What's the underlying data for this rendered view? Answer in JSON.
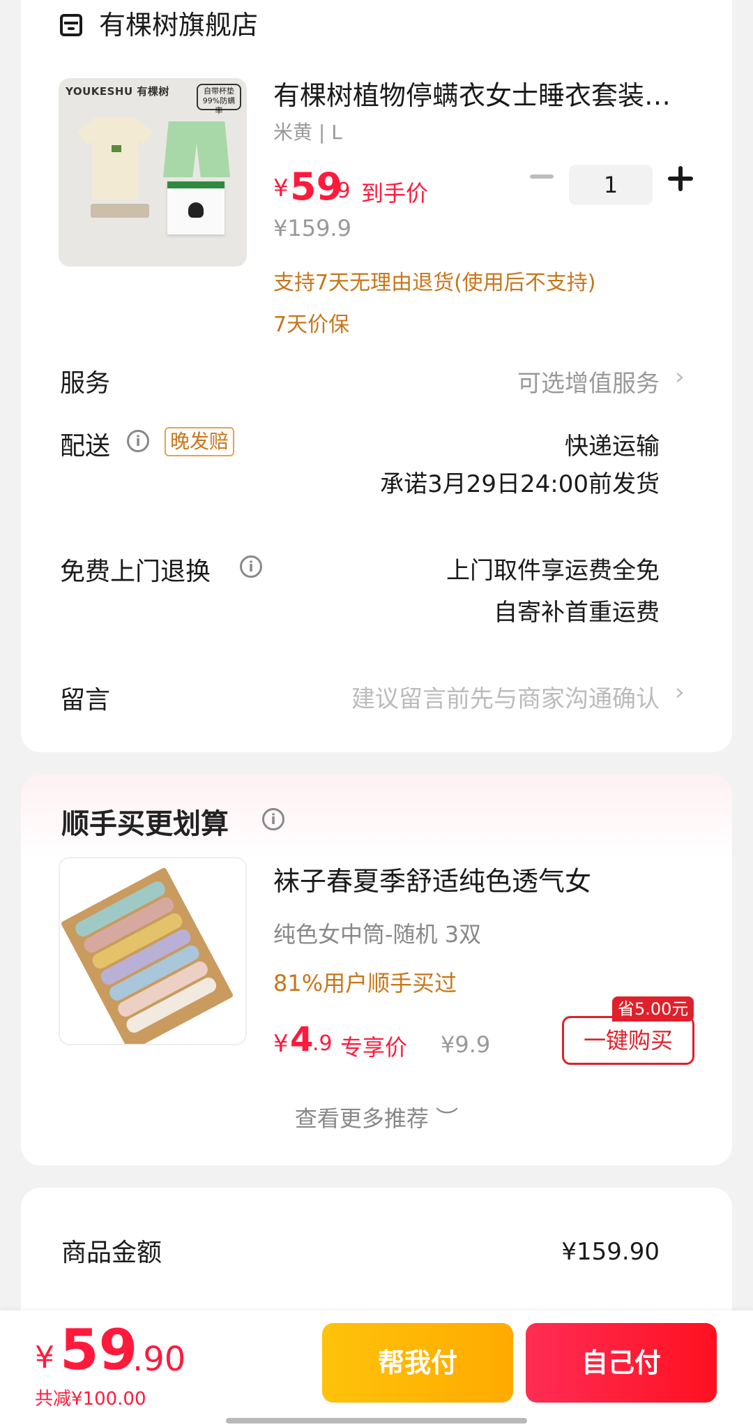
{
  "store": {
    "name": "有棵树旗舰店",
    "icon": "store-icon"
  },
  "product": {
    "image_brand": "YOUKESHU 有棵树",
    "image_tag": "自带杯垫 99%防螨率",
    "title": "有棵树植物停螨衣女士睡衣套装…",
    "variant": "米黄 | L",
    "price_symbol": "¥",
    "price_int": "59",
    "price_dec": ".9",
    "price_tag": "到手价",
    "original_price": "¥159.9",
    "quantity": "1",
    "return_policy": "支持7天无理由退货(使用后不支持)",
    "price_protect": "7天价保"
  },
  "service": {
    "label": "服务",
    "value": "可选增值服务"
  },
  "delivery": {
    "label": "配送",
    "badge": "晚发赔",
    "method": "快递运输",
    "promise": "承诺3月29日24:00前发货"
  },
  "return_exchange": {
    "label": "免费上门退换",
    "line1": "上门取件享运费全免",
    "line2": "自寄补首重运费"
  },
  "message": {
    "label": "留言",
    "placeholder": "建议留言前先与商家沟通确认"
  },
  "addon": {
    "section_title": "顺手买更划算",
    "title": "袜子春夏季舒适纯色透气女",
    "variant": "纯色女中筒-随机 3双",
    "bought": "81%用户顺手买过",
    "price_symbol": "¥",
    "price_int": "4",
    "price_dec": ".9",
    "price_tag": "专享价",
    "original_price": "¥9.9",
    "save_tag": "省5.00元",
    "buy_button": "一键购买",
    "see_more": "查看更多推荐 ︶"
  },
  "summary": {
    "label": "商品金额",
    "value": "¥159.90"
  },
  "checkout": {
    "total_symbol": "¥",
    "total_int": "59",
    "total_dec": ".90",
    "discount": "共减¥100.00",
    "help_pay": "帮我付",
    "self_pay": "自己付"
  },
  "colors": {
    "accent_red": "#ff1a3c",
    "orange_text": "#c8761a",
    "help_btn": "#ffb300",
    "self_btn": "#ff1a3c"
  }
}
